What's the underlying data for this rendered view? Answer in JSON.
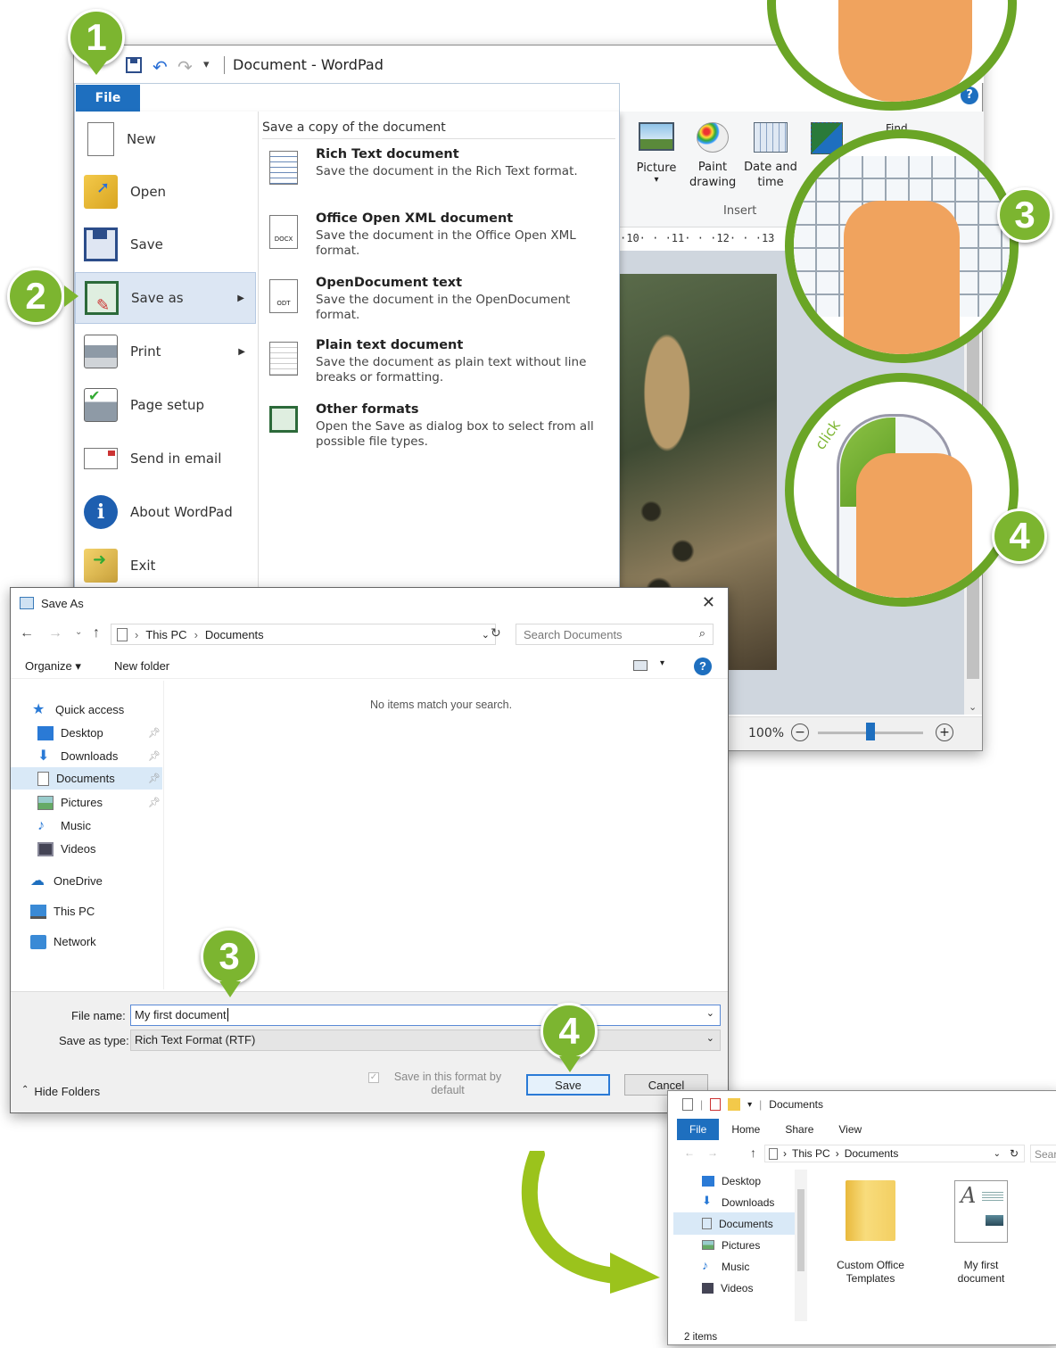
{
  "wordpad": {
    "title": "Document - WordPad",
    "file_tab": "File",
    "menu": [
      "New",
      "Open",
      "Save",
      "Save as",
      "Print",
      "Page setup",
      "Send in email",
      "About WordPad",
      "Exit"
    ],
    "submenu_header": "Save a copy of the document",
    "formats": [
      {
        "title": "Rich Text document",
        "desc": "Save the document in the Rich Text format.",
        "icon_label": ""
      },
      {
        "title": "Office Open XML document",
        "desc": "Save the document in the Office Open XML format.",
        "icon_label": "DOCX"
      },
      {
        "title": "OpenDocument text",
        "desc": "Save the document in the OpenDocument format.",
        "icon_label": "ODT"
      },
      {
        "title": "Plain text document",
        "desc": "Save the document as plain text without line breaks or formatting.",
        "icon_label": ""
      },
      {
        "title": "Other formats",
        "desc": "Open the Save as dialog box to select from all possible file types.",
        "icon_label": ""
      }
    ],
    "ribbon": {
      "picture": "Picture",
      "paint": "Paint drawing",
      "datetime": "Date and time",
      "group": "Insert",
      "find": "Find"
    },
    "ruler": "·10· · ·11· · ·12· · ·13",
    "zoom": "100%"
  },
  "saveas": {
    "title": "Save As",
    "path": [
      "This PC",
      "Documents"
    ],
    "search_placeholder": "Search Documents",
    "organize": "Organize ▾",
    "new_folder": "New folder",
    "empty_msg": "No items match your search.",
    "sidebar": [
      {
        "label": "Quick access",
        "icon": "star-icon",
        "pin": false
      },
      {
        "label": "Desktop",
        "icon": "desktop-icon",
        "pin": true
      },
      {
        "label": "Downloads",
        "icon": "download-icon",
        "pin": true
      },
      {
        "label": "Documents",
        "icon": "documents-icon",
        "pin": true
      },
      {
        "label": "Pictures",
        "icon": "pictures-icon",
        "pin": true
      },
      {
        "label": "Music",
        "icon": "music-icon",
        "pin": false
      },
      {
        "label": "Videos",
        "icon": "videos-icon",
        "pin": false
      },
      {
        "label": "OneDrive",
        "icon": "cloud-icon",
        "pin": false
      },
      {
        "label": "This PC",
        "icon": "pc-icon",
        "pin": false
      },
      {
        "label": "Network",
        "icon": "network-icon",
        "pin": false
      }
    ],
    "filename_label": "File name:",
    "filename": "My first document",
    "savetype_label": "Save as type:",
    "savetype": "Rich Text Format (RTF)",
    "checkbox_label": "Save in this format by default",
    "save_btn": "Save",
    "cancel_btn": "Cancel",
    "hide_folders": "Hide Folders"
  },
  "explorer": {
    "title": "Documents",
    "tabs": [
      "File",
      "Home",
      "Share",
      "View"
    ],
    "path": [
      "This PC",
      "Documents"
    ],
    "search_placeholder": "Sear",
    "sidebar": [
      "Desktop",
      "Downloads",
      "Documents",
      "Pictures",
      "Music",
      "Videos"
    ],
    "items": [
      {
        "name": "Custom Office Templates",
        "type": "folder"
      },
      {
        "name": "My first document",
        "type": "rtf"
      }
    ],
    "status": "2 items"
  },
  "callouts": {
    "step1": "1",
    "step2": "2",
    "step3": "3",
    "step4": "4",
    "click": "click"
  },
  "colors": {
    "accent_green": "#7cb530",
    "file_blue": "#1e6fbf",
    "arrow_green": "#9bc31c"
  }
}
